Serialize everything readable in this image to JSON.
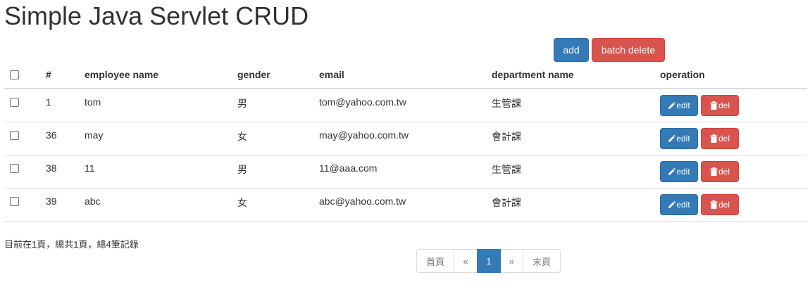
{
  "page": {
    "title": "Simple Java Servlet CRUD"
  },
  "actions": {
    "add_label": "add",
    "batch_delete_label": "batch delete"
  },
  "table": {
    "columns": [
      "#",
      "employee name",
      "gender",
      "email",
      "department name",
      "operation"
    ],
    "rows": [
      {
        "id": "1",
        "name": "tom",
        "gender": "男",
        "email": "tom@yahoo.com.tw",
        "department": "生管課"
      },
      {
        "id": "36",
        "name": "may",
        "gender": "女",
        "email": "may@yahoo.com.tw",
        "department": "會計課"
      },
      {
        "id": "38",
        "name": "11",
        "gender": "男",
        "email": "11@aaa.com",
        "department": "生管課"
      },
      {
        "id": "39",
        "name": "abc",
        "gender": "女",
        "email": "abc@yahoo.com.tw",
        "department": "會計課"
      }
    ],
    "edit_label": "edit",
    "del_label": "del"
  },
  "footer": {
    "page_info": "目前在1頁，總共1頁，總4筆記錄",
    "pagination": {
      "first": "首頁",
      "prev": "«",
      "current": "1",
      "next": "»",
      "last": "末頁"
    }
  },
  "colors": {
    "primary": "#337ab7",
    "danger": "#d9534f",
    "border": "#dddddd"
  },
  "icons": {
    "edit": "pencil-icon",
    "delete": "trash-icon"
  }
}
